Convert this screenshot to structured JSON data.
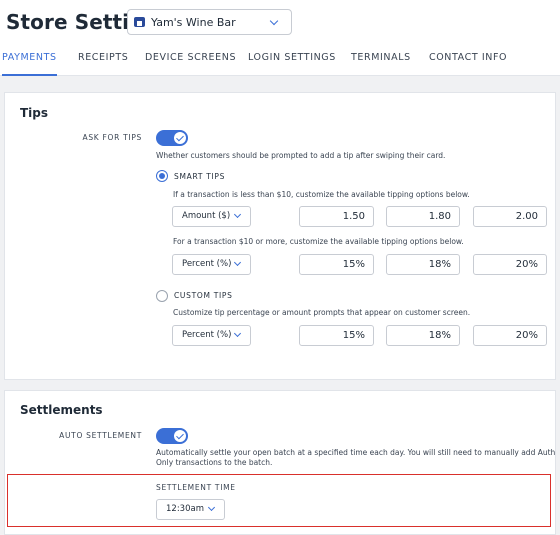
{
  "header": {
    "title": "Store Settings",
    "store_select": {
      "value": "Yam's Wine Bar",
      "icon": "store-icon"
    }
  },
  "tabs": [
    {
      "label": "PAYMENTS",
      "active": true
    },
    {
      "label": "RECEIPTS",
      "active": false
    },
    {
      "label": "DEVICE SCREENS",
      "active": false
    },
    {
      "label": "LOGIN SETTINGS",
      "active": false
    },
    {
      "label": "TERMINALS",
      "active": false
    },
    {
      "label": "CONTACT INFO",
      "active": false
    }
  ],
  "tips": {
    "title": "Tips",
    "ask_label": "ASK FOR TIPS",
    "ask_enabled": true,
    "ask_help": "Whether customers should be prompted to add a tip after swiping their card.",
    "smart": {
      "label": "SMART TIPS",
      "selected": true,
      "under_help": "If a transaction is less than $10, customize the available tipping options below.",
      "under_type": "Amount ($)",
      "under_values": [
        "1.50",
        "1.80",
        "2.00"
      ],
      "over_help": "For a transaction $10 or more, customize the available tipping options below.",
      "over_type": "Percent (%)",
      "over_values": [
        "15%",
        "18%",
        "20%"
      ]
    },
    "custom": {
      "label": "CUSTOM TIPS",
      "selected": false,
      "help": "Customize tip percentage or amount prompts that appear on customer screen.",
      "type": "Percent (%)",
      "values": [
        "15%",
        "18%",
        "20%"
      ]
    }
  },
  "settlements": {
    "title": "Settlements",
    "auto_label": "AUTO SETTLEMENT",
    "auto_enabled": true,
    "auto_help_1": "Automatically settle your open batch at a specified time each day. You will still need to manually add Auth",
    "auto_help_2": "Only transactions to the batch.",
    "time_label": "SETTLEMENT TIME",
    "time_value": "12:30am"
  },
  "colors": {
    "accent": "#3b6fd6",
    "highlight": "#d9302b",
    "background": "#f0f1f3"
  }
}
